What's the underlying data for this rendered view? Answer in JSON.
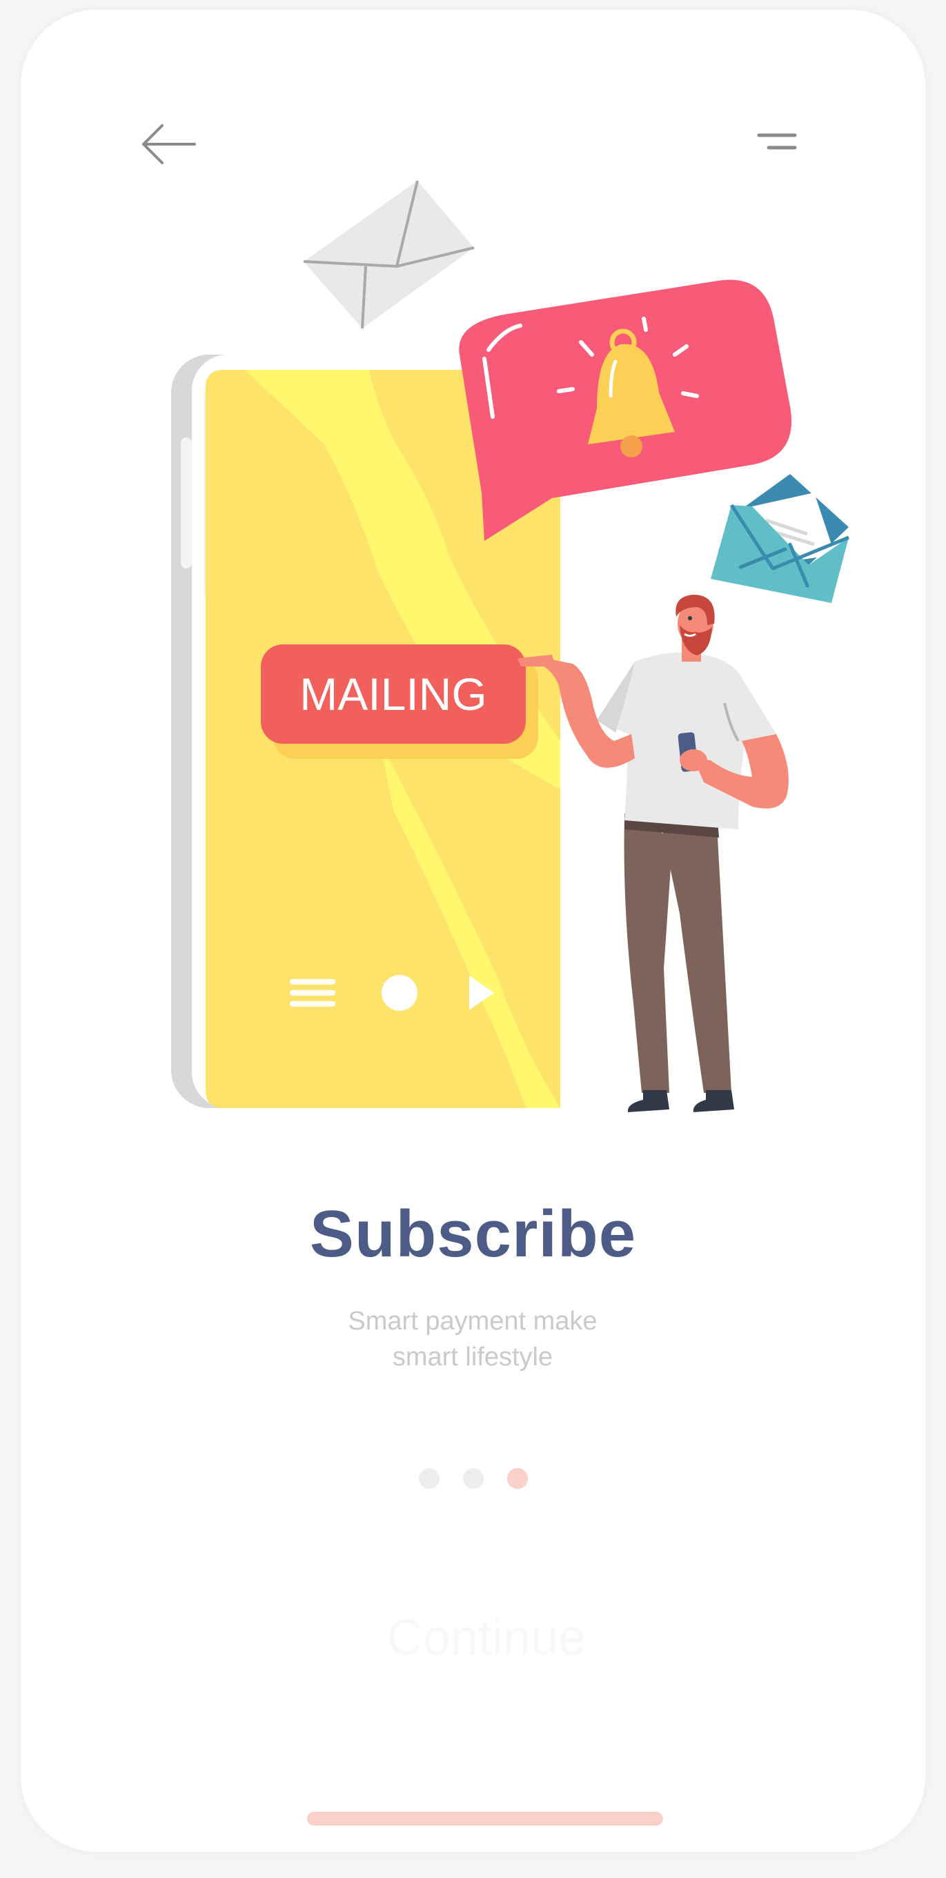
{
  "screen": {
    "title": "Subscribe",
    "subtitle_line1": "Smart payment make",
    "subtitle_line2": "smart lifestyle",
    "continue_label": "Continue"
  },
  "illustration": {
    "mailing_label": "MAILING"
  },
  "icons": {
    "back": "arrow-left-icon",
    "menu": "menu-icon",
    "bell": "bell-icon",
    "envelope": "envelope-icon"
  },
  "pagination": {
    "total": 3,
    "current": 3
  },
  "colors": {
    "title": "#4d5c86",
    "accent": "#fbd0c8",
    "mailing_badge": "#f2605c",
    "notification_bubble": "#f75b77",
    "phone_screen": "#fde36a"
  }
}
